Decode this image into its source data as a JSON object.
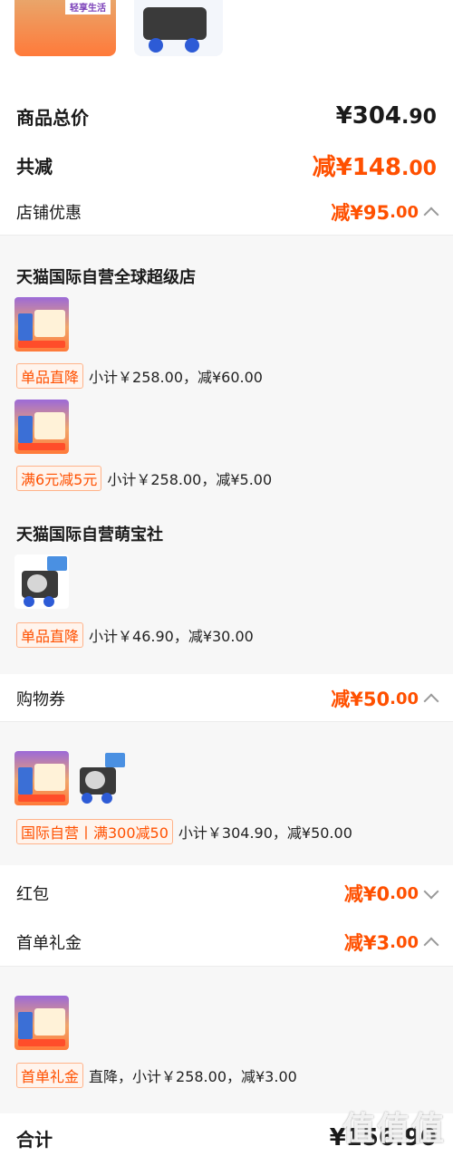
{
  "summary": {
    "total_label": "商品总价",
    "total_yen": "¥304",
    "total_cents": ".90",
    "reduce_label": "共减",
    "reduce_value": "减¥148",
    "reduce_cents": ".00"
  },
  "store_discount": {
    "label": "店铺优惠",
    "value": "减¥95",
    "cents": ".00"
  },
  "stores": [
    {
      "name": "天猫国际自营全球超级店",
      "items": [
        {
          "tag": "单品直降",
          "text": "小计￥258.00，减¥60.00"
        },
        {
          "tag": "满6元减5元",
          "text": "小计￥258.00，减¥5.00"
        }
      ]
    },
    {
      "name": "天猫国际自营萌宝社",
      "items": [
        {
          "tag": "单品直降",
          "text": "小计￥46.90，减¥30.00"
        }
      ]
    }
  ],
  "coupon": {
    "label": "购物券",
    "value": "减¥50",
    "cents": ".00",
    "tag": "国际自营丨满300减50",
    "text": "小计￥304.90，减¥50.00"
  },
  "redpacket": {
    "label": "红包",
    "value": "减¥0",
    "cents": ".00"
  },
  "first_gift": {
    "label": "首单礼金",
    "value": "减¥3",
    "cents": ".00",
    "tag": "首单礼金",
    "text": "直降，小计￥258.00，减¥3.00"
  },
  "total": {
    "label": "合计",
    "value": "¥156.90"
  },
  "thumb_top": {
    "banner": "轻享生活"
  },
  "watermark": "值值值"
}
